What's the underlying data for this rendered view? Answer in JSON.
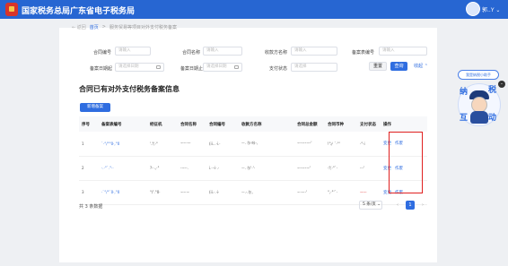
{
  "header": {
    "title": "国家税务总局广东省电子税务局",
    "user_name": "郭..Y ⌄"
  },
  "breadcrumb": {
    "back": "← 返回",
    "home": "首页",
    "separator": ">",
    "current": "服务贸易等项目对外支付税务备案"
  },
  "filters": {
    "contract_no": {
      "label": "合同编号",
      "placeholder": "请输入"
    },
    "contract_name": {
      "label": "合同名称",
      "placeholder": "请输入"
    },
    "payee_name": {
      "label": "收款方名称",
      "placeholder": "请输入"
    },
    "filing_no": {
      "label": "备案表编号",
      "placeholder": "请输入"
    },
    "filing_date": {
      "label": "备案日期起",
      "placeholder": "请选择日期"
    },
    "filing_date_end": {
      "label": "备案日期止",
      "placeholder": "请选择日期"
    },
    "payment_status": {
      "label": "支付状态",
      "placeholder": "请选择"
    }
  },
  "buttons": {
    "reset": "重置",
    "search": "查询",
    "collapse": "收起 ⌃",
    "add": "新增备案"
  },
  "section_title": "合同已有对外支付税务备案信息",
  "table": {
    "columns": [
      "序号",
      "备案表编号",
      "经征机",
      "合同名称",
      "合同编号",
      "收款方名称",
      "合同总金额",
      "合同币种",
      "支付状态",
      "操作"
    ],
    "rows": [
      {
        "index": "1",
        "cells": [
          "`·°/°°0·,°0",
          "'.°,̸·°",
          "ᅮ-·-ᅮ",
          "(ii...·i.·",
          "ᅳ. 尓·咔·,",
          "ᅮ-ᅮ-ᅮ-'",
          "!°,·̸ `·°'",
          "·°·i"
        ],
        "actions": [
          "变更",
          "作废"
        ]
      },
      {
        "index": "2",
        "cells": [
          "·.·°`.°··",
          "?··.,·°",
          "·ᅮ-·.",
          "i.···i·.·",
          "ᅳ. 尓'·'·",
          "ᅮ-ᅮ-ᅮ'",
          "·°,̸·°`·",
          "··-'"
        ],
        "actions": [
          "变更",
          "作废"
        ]
      },
      {
        "index": "3",
        "cells": [
          "·`°/°`0·,°0",
          "°/'.°0·",
          "ᅮ-·ᅮ",
          "(ii.·.·i·",
          "ᅳ.·.尓,",
          "ᅮ·ᅮ·'",
          "°,·°'`·",
          "—ᅮ"
        ],
        "actions": [
          "变更",
          "作废"
        ]
      }
    ]
  },
  "pagination": {
    "total": "共 3 条数据",
    "page_size": "5 条/页  ⌄",
    "prev": "‹",
    "page": "1",
    "next": "›"
  },
  "assistant": {
    "bubble": "我是纳税小助手",
    "chars": [
      "纳",
      "税",
      "互",
      "动"
    ],
    "close": "-"
  },
  "colors": {
    "topbar": "#2766d2",
    "accent": "#2f6de0",
    "highlight_box": "#e02020"
  }
}
